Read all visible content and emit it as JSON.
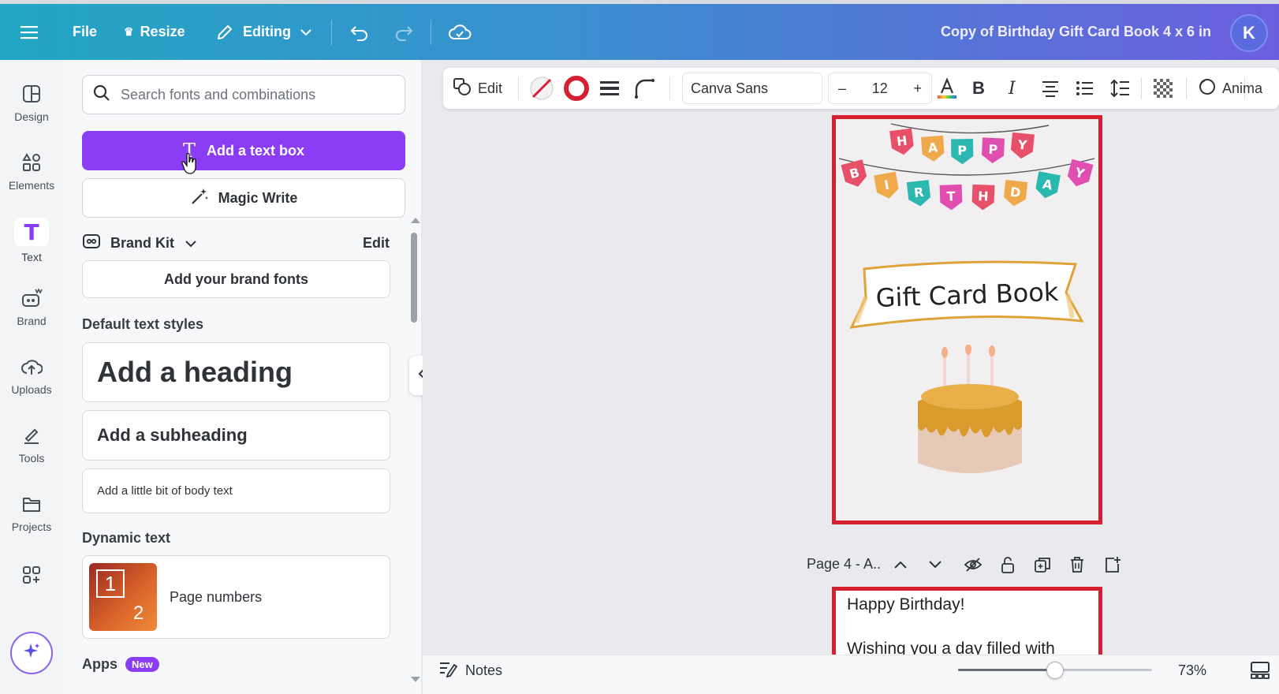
{
  "topbar": {
    "file": "File",
    "resize": "Resize",
    "editing": "Editing",
    "doc_title": "Copy of Birthday Gift Card Book 4 x 6 in",
    "avatar_initial": "K",
    "gradient_start": "#22a6c3",
    "gradient_end": "#6b5fe0"
  },
  "rail": {
    "items": [
      {
        "label": "Design",
        "icon": "design-icon"
      },
      {
        "label": "Elements",
        "icon": "elements-icon"
      },
      {
        "label": "Text",
        "icon": "text-icon"
      },
      {
        "label": "Brand",
        "icon": "brand-icon"
      },
      {
        "label": "Uploads",
        "icon": "uploads-icon"
      },
      {
        "label": "Tools",
        "icon": "tools-icon"
      },
      {
        "label": "Projects",
        "icon": "projects-icon"
      }
    ]
  },
  "panel": {
    "search_placeholder": "Search fonts and combinations",
    "add_text_box": "Add a text box",
    "magic_write": "Magic Write",
    "brand_kit": "Brand Kit",
    "brand_edit": "Edit",
    "add_brand_fonts": "Add your brand fonts",
    "default_styles_title": "Default text styles",
    "heading": "Add a heading",
    "subheading": "Add a subheading",
    "body": "Add a little bit of body text",
    "dynamic_title": "Dynamic text",
    "page_numbers": "Page numbers",
    "apps_title": "Apps",
    "apps_badge": "New",
    "accent": "#8b3df5"
  },
  "toolbar": {
    "edit": "Edit",
    "font": "Canva Sans",
    "size": "12",
    "minus": "–",
    "plus": "+",
    "animate": "Anima"
  },
  "canvas": {
    "bunting_top": [
      "H",
      "A",
      "P",
      "P",
      "Y"
    ],
    "bunting_bottom": [
      "B",
      "I",
      "R",
      "T",
      "H",
      "D",
      "A",
      "Y"
    ],
    "banner_text": "Gift Card Book",
    "page_label": "Page 4 - A..",
    "page2_line1": "Happy Birthday!",
    "page2_line2": "Wishing you a day filled with",
    "border_color": "#d62032"
  },
  "footer": {
    "notes": "Notes",
    "zoom": "73%",
    "zoom_level": 0.5
  }
}
